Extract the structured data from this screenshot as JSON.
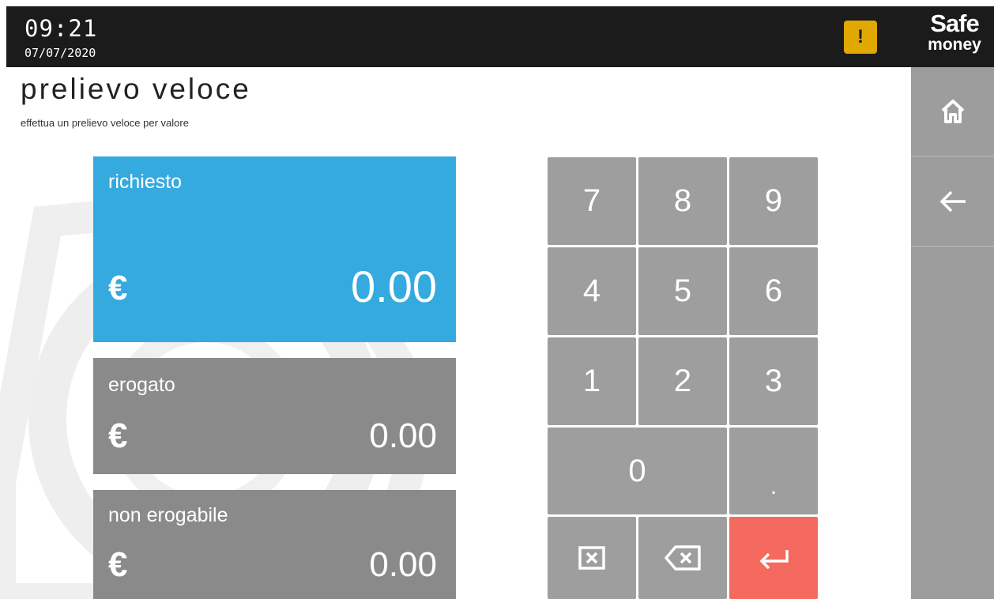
{
  "header": {
    "time": "09:21",
    "date": "07/07/2020",
    "alert_icon": "warning-icon",
    "alert_symbol": "!",
    "logo_line1": "Safe",
    "logo_line2": "money"
  },
  "page": {
    "title": "prelievo veloce",
    "subtitle": "effettua un prelievo veloce per valore"
  },
  "sidebar": {
    "items": [
      {
        "icon": "home-icon"
      },
      {
        "icon": "back-arrow-icon"
      }
    ]
  },
  "panels": {
    "richiesto": {
      "label": "richiesto",
      "currency": "€",
      "value": "0.00"
    },
    "erogato": {
      "label": "erogato",
      "currency": "€",
      "value": "0.00"
    },
    "non_erogabile": {
      "label": "non erogabile",
      "currency": "€",
      "value": "0.00"
    }
  },
  "keypad": {
    "k7": "7",
    "k8": "8",
    "k9": "9",
    "k4": "4",
    "k5": "5",
    "k6": "6",
    "k1": "1",
    "k2": "2",
    "k3": "3",
    "k0": "0",
    "kdot": ".",
    "clear_icon": "clear-icon",
    "backspace_icon": "backspace-icon",
    "enter_icon": "enter-icon"
  },
  "colors": {
    "accent": "#35aadf",
    "panel_gray": "#8a8a8a",
    "key_gray": "#9e9e9e",
    "enter": "#f46a5e",
    "alert": "#e0a800",
    "topbar": "#1b1b1b"
  }
}
